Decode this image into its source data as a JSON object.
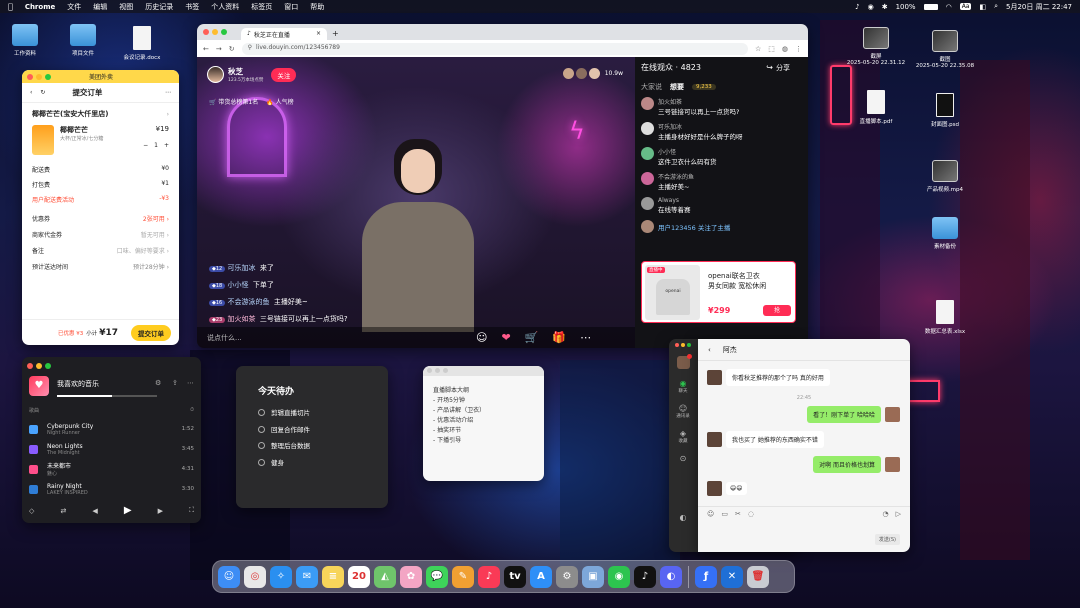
{
  "menubar": {
    "app": "Chrome",
    "items": [
      "文件",
      "编辑",
      "视图",
      "历史记录",
      "书签",
      "个人资料",
      "标签页",
      "窗口",
      "帮助"
    ],
    "battery": "100%",
    "ime": "Aa",
    "datetime": "5月20日 周二  22:47"
  },
  "desktop": {
    "left_icons": [
      {
        "label": "工作资料",
        "type": "folder"
      },
      {
        "label": "项目文件",
        "type": "folder"
      },
      {
        "label": "会议记录.docx",
        "type": "doc"
      }
    ],
    "right_icons": [
      {
        "label": "截屏\n2025-05-20 22.31.12",
        "type": "image"
      },
      {
        "label": "截图\n2025-05-20 22.35.08",
        "type": "image"
      },
      {
        "label": "直播脚本.pdf",
        "type": "doc"
      },
      {
        "label": "封面图.psd",
        "type": "doc"
      },
      {
        "label": "产品视频.mp4",
        "type": "image"
      },
      {
        "label": "素材备份",
        "type": "folder"
      },
      {
        "label": "数据汇总表.xlsx",
        "type": "doc"
      }
    ]
  },
  "browser": {
    "tab_title": "秋芝正在直播",
    "url": "live.douyin.com/123456789",
    "streamer": {
      "name": "秋芝",
      "fans": "123.5万本场点赞",
      "follow_label": "关注",
      "viewers_count": "10.9w"
    },
    "rank_tags": [
      "带货总榜第1名",
      "人气榜"
    ],
    "overlay_comments": [
      {
        "level": "12",
        "user": "可乐加冰",
        "text": "来了"
      },
      {
        "level": "18",
        "user": "小小怪",
        "text": "下单了"
      },
      {
        "level": "16",
        "user": "不会游泳的鱼",
        "text": "主播好美~"
      },
      {
        "level": "23",
        "user": "加火如茶",
        "text": "三号链接可以再上一点货吗?"
      }
    ],
    "say_placeholder": "说点什么...",
    "online_label": "在线观众 · 4823",
    "share_label": "分享",
    "chat_tabs": [
      "大家说",
      "想要"
    ],
    "chat_badge": "9,233",
    "chat_list": [
      {
        "user": "加火如茶",
        "text": "三号链接可以再上一点货吗?"
      },
      {
        "user": "可乐加冰",
        "text": "主播身材好好是什么牌子的呀"
      },
      {
        "user": "小小怪",
        "text": "这件卫衣什么码有货"
      },
      {
        "user": "不会游泳的鱼",
        "text": "主播好美~"
      },
      {
        "user": "Always",
        "text": "在线等着赛"
      }
    ],
    "follow_notice": "用户123456 关注了主播",
    "product": {
      "tag": "直播中",
      "name": "openai联名卫衣",
      "desc": "男女同款 宽松休闲",
      "price": "¥299",
      "buy_label": "抢",
      "shirt_text": "openai"
    }
  },
  "order": {
    "header": "美团外卖",
    "title": "提交订单",
    "shop": "椰椰芒芒(宝安大仟里店)",
    "item": {
      "name": "椰椰芒芒",
      "spec": "大杯/正常冰/七分糖",
      "price": "¥19",
      "qty": "1"
    },
    "fees": [
      {
        "label": "配送费",
        "value": "¥0"
      },
      {
        "label": "打包费",
        "value": "¥1"
      },
      {
        "label": "用户配送费活动",
        "value": "-¥3",
        "red": true
      }
    ],
    "options": [
      {
        "label": "优惠券",
        "value": "2张可用 ›",
        "red": true
      },
      {
        "label": "商家代金券",
        "value": "暂无可用 ›"
      },
      {
        "label": "备注",
        "value": "口味、偏好等要求 ›"
      },
      {
        "label": "预计送达时间",
        "value": "预计28分钟 ›"
      }
    ],
    "saved": "已优惠 ¥3",
    "subtotal_label": "小计",
    "total": "¥17",
    "submit_label": "提交订单"
  },
  "music": {
    "title": "我喜欢的音乐",
    "col_title": "歌曲",
    "col_time": "⏱",
    "songs": [
      {
        "name": "Cyberpunk City",
        "artist": "Night Runner",
        "time": "1:52",
        "color": "#4aa3ff"
      },
      {
        "name": "Neon Lights",
        "artist": "The Midnight",
        "time": "3:45",
        "color": "#8a5cff"
      },
      {
        "name": "未来都市",
        "artist": "魅心",
        "time": "4:31",
        "color": "#ff4f8b"
      },
      {
        "name": "Rainy Night",
        "artist": "LAKEY INSPIRED",
        "time": "3:30",
        "color": "#2f7dd6"
      }
    ]
  },
  "todo": {
    "title": "今天待办",
    "items": [
      "剪辑直播切片",
      "回复合作邮件",
      "整理后台数据",
      "健身"
    ]
  },
  "note": {
    "lines": [
      "直播脚本大纲",
      "- 开场5分钟",
      "- 产品讲解（卫衣）",
      "- 优惠活动介绍",
      "- 抽奖环节",
      "- 下播引导"
    ]
  },
  "wechat": {
    "contact": "阿杰",
    "time": "22:45",
    "send_label": "发送(S)",
    "messages": [
      {
        "side": "left",
        "text": "你看秋芝推荐的那个了吗 真的好用"
      },
      {
        "side": "right",
        "text": "看了！刚下单了 哈哈哈"
      },
      {
        "side": "left",
        "text": "我也买了 她推荐的东西确实不错"
      },
      {
        "side": "right",
        "text": "对啊 而且价格也划算"
      },
      {
        "side": "left",
        "text": "😄😄"
      }
    ],
    "sidebar_labels": [
      "聊天",
      "通讯录",
      "收藏"
    ]
  },
  "dock": [
    {
      "name": "finder",
      "color": "#3d8df5",
      "g": "☺"
    },
    {
      "name": "chrome",
      "color": "#e8e8e8",
      "g": "◎"
    },
    {
      "name": "safari",
      "color": "#2a8ff0",
      "g": "✧"
    },
    {
      "name": "mail",
      "color": "#3b9cf6",
      "g": "✉"
    },
    {
      "name": "notes",
      "color": "#f7d55a",
      "g": "≡"
    },
    {
      "name": "calendar",
      "color": "#ffffff",
      "g": "20"
    },
    {
      "name": "maps",
      "color": "#6fc46b",
      "g": "◭"
    },
    {
      "name": "photos",
      "color": "#f3a5c4",
      "g": "✿"
    },
    {
      "name": "messages",
      "color": "#3ed35a",
      "g": "💬"
    },
    {
      "name": "pages",
      "color": "#f0a032",
      "g": "✎"
    },
    {
      "name": "music",
      "color": "#fa3a56",
      "g": "♪"
    },
    {
      "name": "tv",
      "color": "#111111",
      "g": "tv"
    },
    {
      "name": "appstore",
      "color": "#2e8ff7",
      "g": "A"
    },
    {
      "name": "settings",
      "color": "#8c8c8c",
      "g": "⚙"
    },
    {
      "name": "preview",
      "color": "#7da7d9",
      "g": "▣"
    },
    {
      "name": "wechat",
      "color": "#2dc44f",
      "g": "◉"
    },
    {
      "name": "douyin",
      "color": "#111111",
      "g": "♪"
    },
    {
      "name": "discord",
      "color": "#5865f2",
      "g": "◐"
    },
    {
      "name": "lark",
      "color": "#3570f6",
      "g": "ƒ"
    },
    {
      "name": "xcode",
      "color": "#1f6fd6",
      "g": "✕"
    },
    {
      "name": "trash",
      "color": "#c9ccd2",
      "g": "🗑"
    }
  ]
}
